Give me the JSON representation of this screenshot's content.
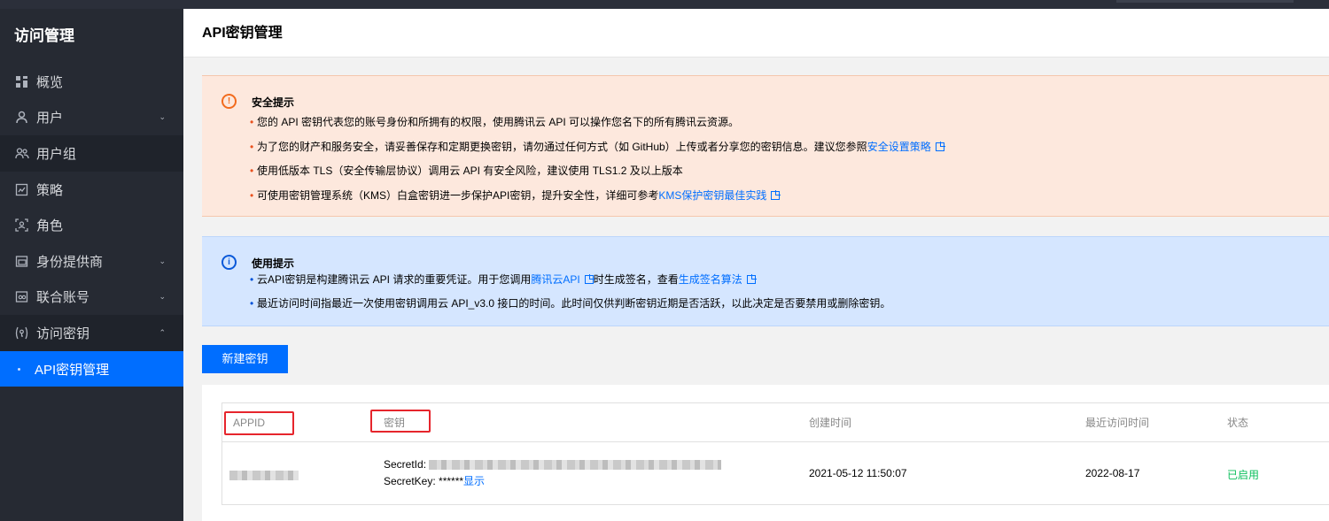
{
  "sidebar": {
    "title": "访问管理",
    "items": [
      {
        "label": "概览",
        "icon": "overview-grid-icon",
        "chevron": ""
      },
      {
        "label": "用户",
        "icon": "user-icon",
        "chevron": "⌄"
      },
      {
        "label": "用户组",
        "icon": "user-group-icon",
        "chevron": ""
      },
      {
        "label": "策略",
        "icon": "policy-icon",
        "chevron": ""
      },
      {
        "label": "角色",
        "icon": "role-icon",
        "chevron": ""
      },
      {
        "label": "身份提供商",
        "icon": "identity-provider-icon",
        "chevron": "⌄"
      },
      {
        "label": "联合账号",
        "icon": "federated-account-icon",
        "chevron": "⌄"
      },
      {
        "label": "访问密钥",
        "icon": "access-key-icon",
        "chevron": "⌃"
      }
    ],
    "active_item": "API密钥管理"
  },
  "page": {
    "title": "API密钥管理"
  },
  "security_notice": {
    "title": "安全提示",
    "lines": [
      {
        "text": "您的 API 密钥代表您的账号身份和所拥有的权限，使用腾讯云 API 可以操作您名下的所有腾讯云资源。"
      },
      {
        "text": "为了您的财产和服务安全，请妥善保存和定期更换密钥，请勿通过任何方式（如 GitHub）上传或者分享您的密钥信息。建议您参照",
        "link": "安全设置策略"
      },
      {
        "text": "使用低版本 TLS（安全传输层协议）调用云 API 有安全风险，建议使用 TLS1.2 及以上版本"
      },
      {
        "text": "可使用密钥管理系统（KMS）白盒密钥进一步保护API密钥，提升安全性，详细可参考",
        "link": "KMS保护密钥最佳实践"
      }
    ]
  },
  "usage_notice": {
    "title": "使用提示",
    "line1_a": "云API密钥是构建腾讯云 API 请求的重要凭证。用于您调用",
    "line1_link1": "腾讯云API",
    "line1_b": "时生成签名，查看",
    "line1_link2": "生成签名算法",
    "line2": "最近访问时间指最近一次使用密钥调用云 API_v3.0 接口的时间。此时间仅供判断密钥近期是否活跃，以此决定是否要禁用或删除密钥。"
  },
  "create_button": "新建密钥",
  "table": {
    "columns": [
      "APPID",
      "密钥",
      "创建时间",
      "最近访问时间",
      "状态"
    ],
    "rows": [
      {
        "secret_id_label": "SecretId:",
        "secret_key_label": "SecretKey: ******",
        "show_link": "显示",
        "created": "2021-05-12 11:50:07",
        "last_access": "2022-08-17",
        "status": "已启用"
      }
    ]
  },
  "colors": {
    "sidebar_bg": "#262a33",
    "active_blue": "#006eff",
    "warning_bg": "#fde8dd",
    "info_bg": "#d5e6ff",
    "status_green": "#0abf5b",
    "highlight_red": "#e6252c"
  }
}
